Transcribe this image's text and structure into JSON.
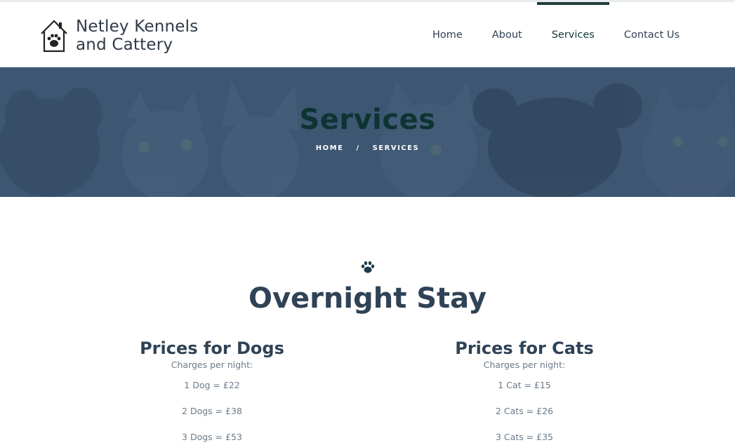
{
  "header": {
    "logo_line1": "Netley Kennels",
    "logo_line2": "and Cattery",
    "logo_icon": "house-paw-icon",
    "nav": [
      {
        "label": "Home",
        "active": false
      },
      {
        "label": "About",
        "active": false
      },
      {
        "label": "Services",
        "active": true
      },
      {
        "label": "Contact Us",
        "active": false
      }
    ]
  },
  "hero": {
    "title": "Services",
    "breadcrumb": {
      "home": "HOME",
      "separator": "/",
      "current": "SERVICES"
    },
    "background_image": "dogs-and-cats-photo"
  },
  "content": {
    "icon": "paw-icon",
    "title": "Overnight Stay",
    "dogs": {
      "heading": "Prices for Dogs",
      "subheading": "Charges per night:",
      "prices": [
        "1 Dog = £22",
        "2 Dogs = £38",
        "3 Dogs = £53"
      ]
    },
    "cats": {
      "heading": "Prices for Cats",
      "subheading": "Charges per night:",
      "prices": [
        "1 Cat = £15",
        "2 Cats = £26",
        "3 Cats = £35"
      ]
    }
  },
  "colors": {
    "nav_active_bar": "#1f3a3a",
    "hero_overlay": "#3d5570",
    "hero_title": "#0d3333",
    "heading": "#2f4256",
    "body_text": "#6c7a89"
  }
}
